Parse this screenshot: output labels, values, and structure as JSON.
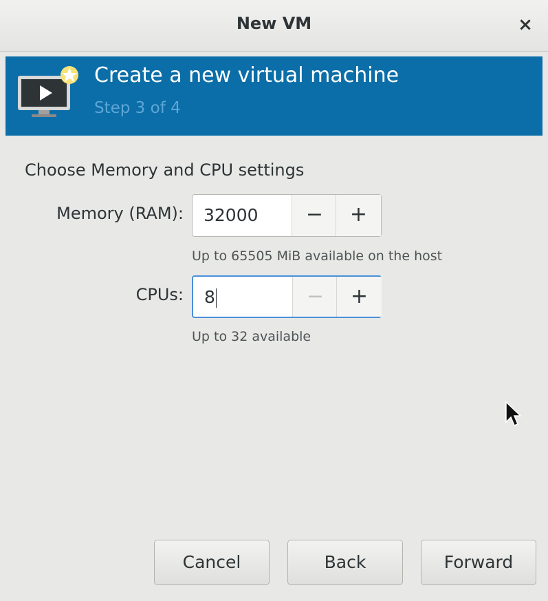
{
  "window": {
    "title": "New VM",
    "close_symbol": "×"
  },
  "banner": {
    "icon": "vm-monitor-new-icon",
    "heading": "Create a new virtual machine",
    "step": "Step 3 of 4",
    "bg_color": "#0b6ea8"
  },
  "form": {
    "section_title": "Choose Memory and CPU settings",
    "memory": {
      "label": "Memory (RAM):",
      "value": "32000",
      "minus": "−",
      "plus": "+",
      "hint": "Up to 65505 MiB available on the host"
    },
    "cpus": {
      "label": "CPUs:",
      "value": "8",
      "minus": "−",
      "plus": "+",
      "hint": "Up to 32 available"
    }
  },
  "footer": {
    "cancel_label": "Cancel",
    "back_label": "Back",
    "forward_label": "Forward"
  }
}
